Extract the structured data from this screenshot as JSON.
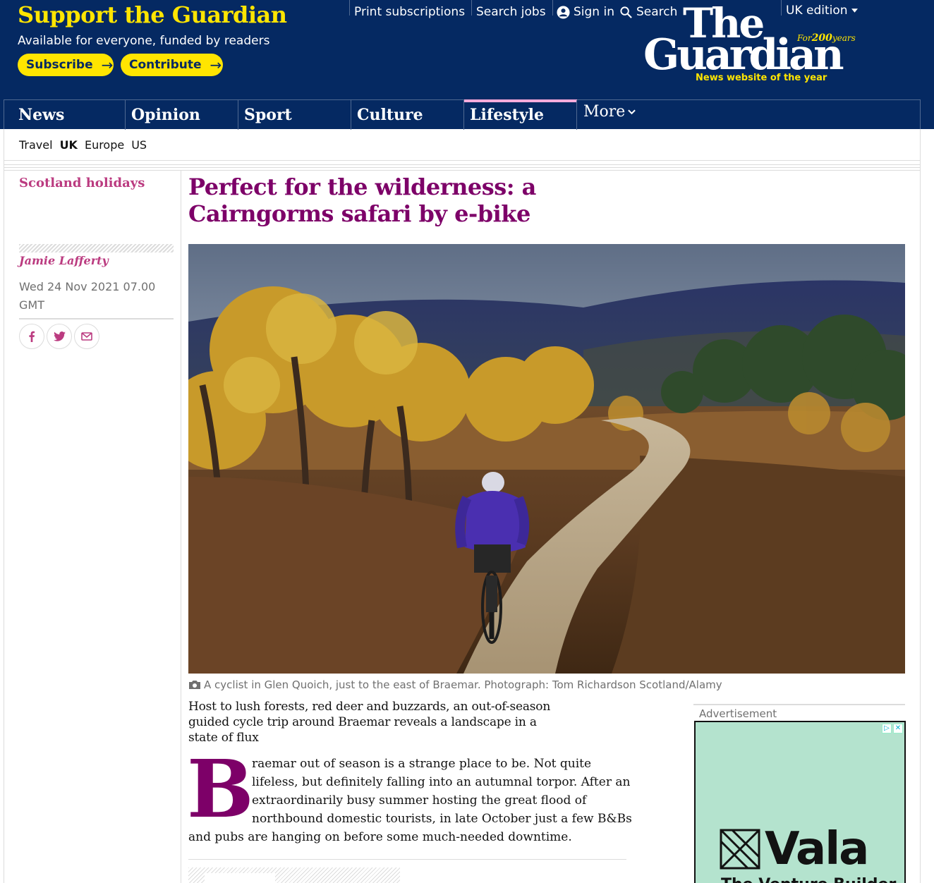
{
  "support": {
    "title": "Support the Guardian",
    "subtitle": "Available for everyone, funded by readers",
    "subscribe_label": "Subscribe",
    "contribute_label": "Contribute"
  },
  "toplinks": {
    "print": "Print subscriptions",
    "jobs": "Search jobs",
    "signin": "Sign in",
    "search": "Search",
    "edition": "UK edition"
  },
  "logo": {
    "the": "The",
    "guardian": "Guardian",
    "for": "For",
    "years_num": "200",
    "years": "years",
    "award": "News website of the year"
  },
  "nav": {
    "pillars": [
      "News",
      "Opinion",
      "Sport",
      "Culture",
      "Lifestyle"
    ],
    "active": "Lifestyle",
    "more": "More"
  },
  "subnav": {
    "items": [
      "Travel",
      "UK",
      "Europe",
      "US"
    ],
    "current": "UK"
  },
  "article": {
    "kicker": "Scotland holidays",
    "byline": "Jamie Lafferty",
    "date": "Wed 24 Nov 2021 07.00 GMT",
    "headline": "Perfect for the wilderness: a Cairngorms safari by e-bike",
    "caption": "A cyclist in Glen Quoich, just to the east of Braemar. Photograph: Tom Richardson Scotland/Alamy",
    "standfirst": "Host to lush forests, red deer and buzzards, an out-of-season guided cycle trip around Braemar reveals a landscape in a state of flux",
    "dropcap": "B",
    "body_lines": [
      "raemar out of season is a strange place to be. Not quite",
      "lifeless, but definitely falling into an autumnal torpor. After an",
      "extraordinarily busy summer hosting the great flood of",
      "northbound domestic tourists, in late October just a few B&Bs",
      "and pubs are hanging on before some much-needed downtime."
    ]
  },
  "advert": {
    "label": "Advertisement",
    "brand": "Vala",
    "tagline": "The Venture Builder"
  },
  "colors": {
    "brand_blue": "#052962",
    "yellow": "#ffe500",
    "lifestyle": "#7d0068",
    "lifestyle_light": "#bb3b80",
    "lifestyle_accent": "#ffabdb",
    "ad_bg": "#b4e3ce"
  }
}
